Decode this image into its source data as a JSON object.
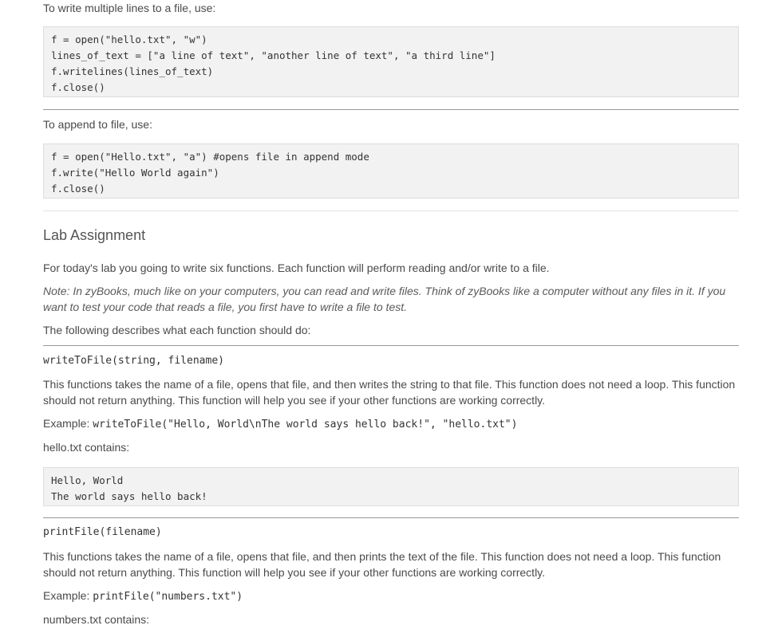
{
  "section_write_lines": {
    "intro": "To write multiple lines to a file, use:",
    "code": [
      "f = open(\"hello.txt\", \"w\")",
      "lines_of_text = [\"a line of text\", \"another line of text\", \"a third line\"]",
      "f.writelines(lines_of_text)",
      "f.close()"
    ]
  },
  "section_append": {
    "intro": "To append to file, use:",
    "code": [
      "f = open(\"Hello.txt\", \"a\") #opens file in append mode",
      "f.write(\"Hello World again\")",
      "f.close()"
    ]
  },
  "lab": {
    "heading": "Lab Assignment",
    "intro": "For today's lab you going to write six functions. Each function will perform reading and/or write to a file.",
    "note": "Note: In zyBooks, much like on your computers, you can read and write files. Think of zyBooks like a computer without any files in it. If you want to test your code that reads a file, you first have to write a file to test.",
    "describes": "The following describes what each function should do:"
  },
  "functions": [
    {
      "signature": "writeToFile(string, filename)",
      "description": "This functions takes the name of a file, opens that file, and then writes the string to that file. This function does not need a loop. This function should not return anything. This function will help you see if your other functions are working correctly.",
      "example_label": "Example: ",
      "example_code": "writeToFile(\"Hello, World\\nThe world says hello back!\", \"hello.txt\")",
      "contains_label": "hello.txt contains:",
      "contains_code": [
        "Hello, World",
        "The world says hello back!"
      ]
    },
    {
      "signature": "printFile(filename)",
      "description": "This functions takes the name of a file, opens that file, and then prints the text of the file. This function does not need a loop. This function should not return anything. This function will help you see if your other functions are working correctly.",
      "example_label": "Example: ",
      "example_code": "printFile(\"numbers.txt\")",
      "contains_label": "numbers.txt contains:"
    }
  ]
}
